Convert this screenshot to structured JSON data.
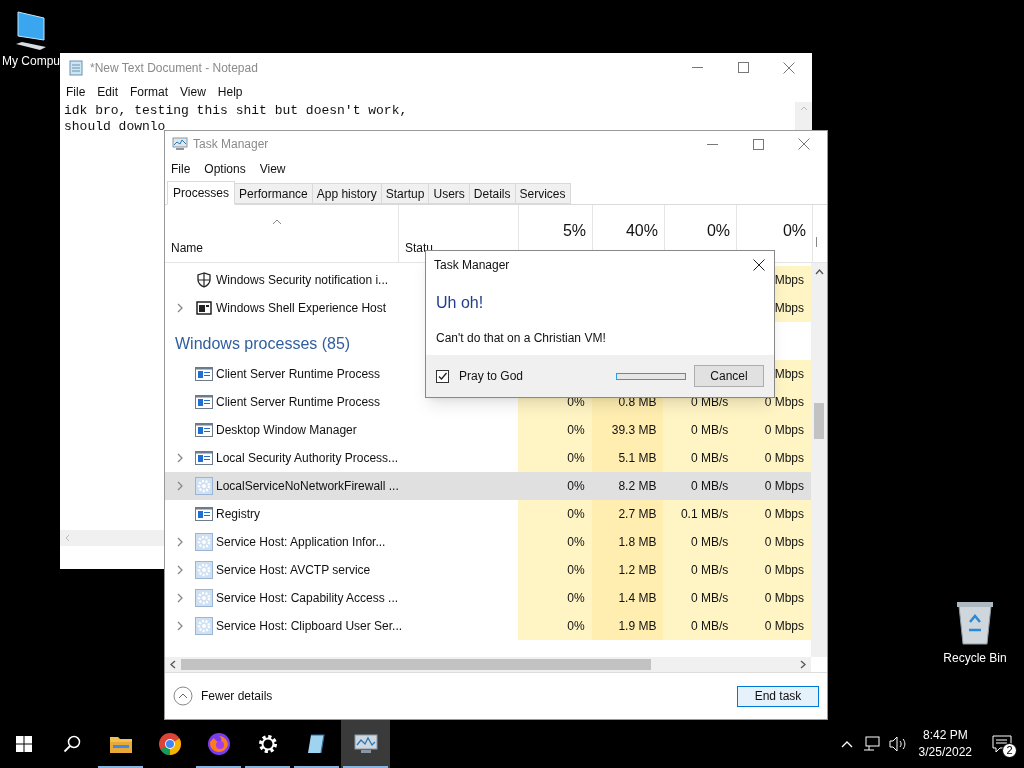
{
  "desktop_icons": [
    {
      "kind": "computer",
      "label": "My Compu"
    },
    {
      "kind": "recycle",
      "label": "Recycle Bin"
    }
  ],
  "notepad": {
    "title": "*New Text Document - Notepad",
    "menu": [
      "File",
      "Edit",
      "Format",
      "View",
      "Help"
    ],
    "lines": [
      "idk bro, testing this shit but doesn't work,",
      "should downlo"
    ]
  },
  "task_manager": {
    "title": "Task Manager",
    "menu": [
      "File",
      "Options",
      "View"
    ],
    "tabs": [
      {
        "label": "Processes",
        "selected": true
      },
      {
        "label": "Performance",
        "selected": false
      },
      {
        "label": "App history",
        "selected": false
      },
      {
        "label": "Startup",
        "selected": false
      },
      {
        "label": "Users",
        "selected": false
      },
      {
        "label": "Details",
        "selected": false
      },
      {
        "label": "Services",
        "selected": false
      }
    ],
    "columns": [
      {
        "label": "Name"
      },
      {
        "label": "Statu"
      },
      {
        "percent": "5%"
      },
      {
        "percent": "40%"
      },
      {
        "percent": "0%"
      },
      {
        "percent": "0%"
      }
    ],
    "rows": [
      {
        "kind": "security",
        "name": "Windows Security notification i...",
        "expandable": false,
        "selected": false,
        "network": "Mbps"
      },
      {
        "kind": "shell",
        "name": "Windows Shell Experience Host",
        "expandable": true,
        "selected": false,
        "network": "Mbps"
      },
      {
        "kind": "group",
        "name": "Windows processes (85)"
      },
      {
        "kind": "system",
        "name": "Client Server Runtime Process",
        "expandable": false,
        "selected": false,
        "network": "Mbps"
      },
      {
        "kind": "system",
        "name": "Client Server Runtime Process",
        "expandable": false,
        "selected": false,
        "cpu": "0%",
        "memory": "0.8 MB",
        "disk": "0 MB/s",
        "network": "0 Mbps"
      },
      {
        "kind": "system",
        "name": "Desktop Window Manager",
        "expandable": false,
        "selected": false,
        "cpu": "0%",
        "memory": "39.3 MB",
        "disk": "0 MB/s",
        "network": "0 Mbps"
      },
      {
        "kind": "system",
        "name": "Local Security Authority Process...",
        "expandable": true,
        "selected": false,
        "cpu": "0%",
        "memory": "5.1 MB",
        "disk": "0 MB/s",
        "network": "0 Mbps"
      },
      {
        "kind": "service",
        "name": "LocalServiceNoNetworkFirewall ...",
        "expandable": true,
        "selected": true,
        "cpu": "0%",
        "memory": "8.2 MB",
        "disk": "0 MB/s",
        "network": "0 Mbps"
      },
      {
        "kind": "system",
        "name": "Registry",
        "expandable": false,
        "selected": false,
        "cpu": "0%",
        "memory": "2.7 MB",
        "disk": "0.1 MB/s",
        "network": "0 Mbps"
      },
      {
        "kind": "service",
        "name": "Service Host: Application Infor...",
        "expandable": true,
        "selected": false,
        "cpu": "0%",
        "memory": "1.8 MB",
        "disk": "0 MB/s",
        "network": "0 Mbps"
      },
      {
        "kind": "service",
        "name": "Service Host: AVCTP service",
        "expandable": true,
        "selected": false,
        "cpu": "0%",
        "memory": "1.2 MB",
        "disk": "0 MB/s",
        "network": "0 Mbps"
      },
      {
        "kind": "service",
        "name": "Service Host: Capability Access ...",
        "expandable": true,
        "selected": false,
        "cpu": "0%",
        "memory": "1.4 MB",
        "disk": "0 MB/s",
        "network": "0 Mbps"
      },
      {
        "kind": "service",
        "name": "Service Host: Clipboard User Ser...",
        "expandable": true,
        "selected": false,
        "cpu": "0%",
        "memory": "1.9 MB",
        "disk": "0 MB/s",
        "network": "0 Mbps"
      }
    ],
    "fewer_details": "Fewer details",
    "end_task": "End task"
  },
  "dialog": {
    "title": "Task Manager",
    "heading": "Uh oh!",
    "message": "Can't do that on a Christian VM!",
    "checkbox": {
      "label": "Pray to God",
      "checked": true
    },
    "progress": {
      "level": 0
    },
    "cancel": "Cancel"
  },
  "taskbar": {
    "apps": [
      {
        "kind": "folder",
        "running": true,
        "selected": false
      },
      {
        "kind": "browser_round",
        "running": false,
        "selected": false
      },
      {
        "kind": "browser_fox",
        "running": true,
        "selected": false
      },
      {
        "kind": "settings",
        "running": true,
        "selected": false
      },
      {
        "kind": "notepad",
        "running": true,
        "selected": false
      },
      {
        "kind": "monitor",
        "running": true,
        "selected": true
      }
    ],
    "time": "8:42 PM",
    "date": "3/25/2022",
    "notifications": "2"
  }
}
